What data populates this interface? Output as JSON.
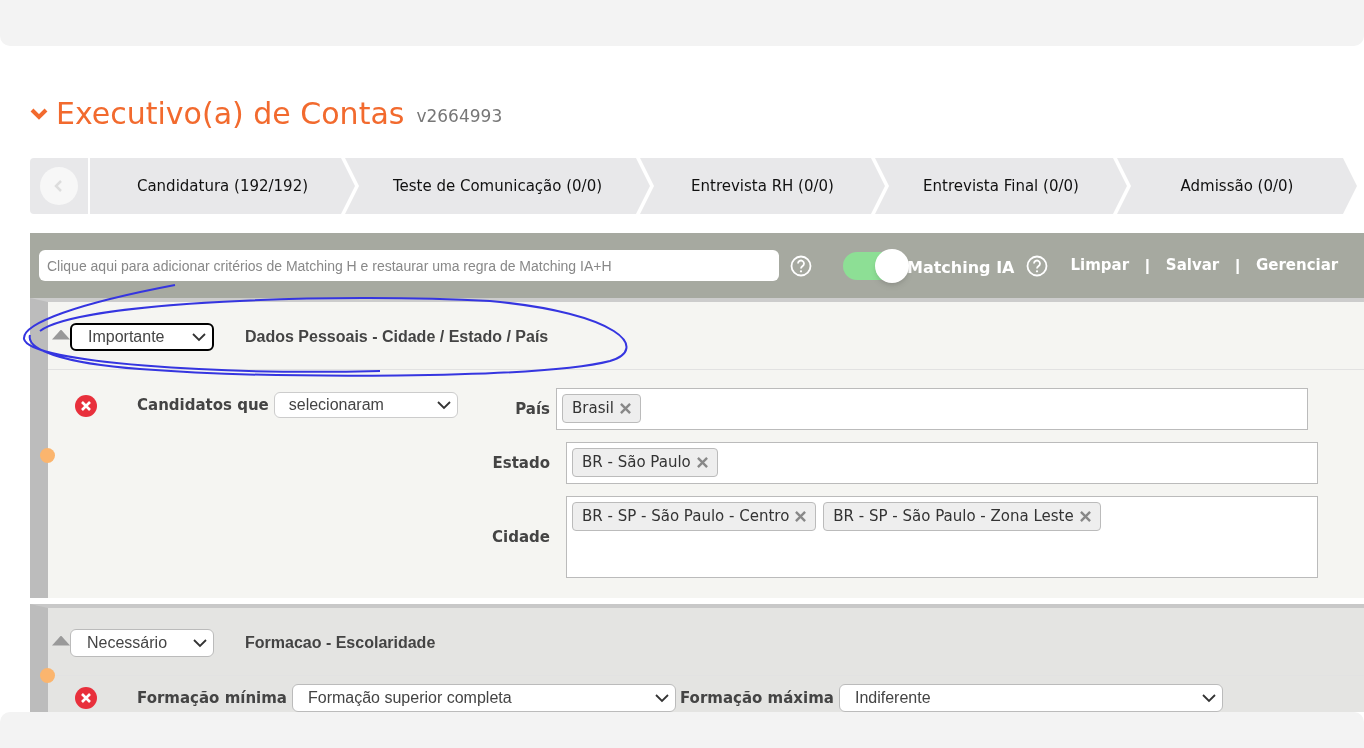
{
  "title": "Executivo(a) de Contas",
  "version": "v2664993",
  "stages": [
    {
      "label": "Candidatura (192/192)"
    },
    {
      "label": "Teste de Comunicação (0/0)"
    },
    {
      "label": "Entrevista RH (0/0)"
    },
    {
      "label": "Entrevista Final (0/0)"
    },
    {
      "label": "Admissão (0/0)"
    }
  ],
  "toolbar": {
    "search": {
      "placeholder": "Clique aqui para adicionar critérios de Matching H e restaurar uma regra de Matching IA+H"
    },
    "matching": {
      "label": "Matching IA",
      "on": true
    },
    "links": [
      {
        "kind": "link",
        "label": "Limpar"
      },
      {
        "kind": "separator",
        "label": "|"
      },
      {
        "kind": "link",
        "label": "Salvar"
      },
      {
        "kind": "separator",
        "label": "|"
      },
      {
        "kind": "link",
        "label": "Gerenciar"
      }
    ]
  },
  "sections": [
    {
      "priority": "Importante",
      "focused": true,
      "title": "Dados Pessoais - Cidade / Estado / País",
      "kind": "location",
      "criterion": {
        "label": "Candidatos que",
        "mode": "selecionaram"
      },
      "fields": [
        {
          "label": "País",
          "tags": [
            "Brasil"
          ]
        },
        {
          "label": "Estado",
          "tags": [
            "BR - São Paulo"
          ]
        },
        {
          "label": "Cidade",
          "tags": [
            "BR - SP - São Paulo - Centro",
            "BR - SP - São Paulo - Zona Leste"
          ]
        }
      ]
    },
    {
      "priority": "Necessário",
      "focused": false,
      "title": "Formacao - Escolaridade",
      "kind": "range",
      "fields": [
        {
          "label": "Formação mínima",
          "value": "Formação superior completa"
        },
        {
          "label": "Formação máxima",
          "value": "Indiferente"
        }
      ]
    }
  ]
}
